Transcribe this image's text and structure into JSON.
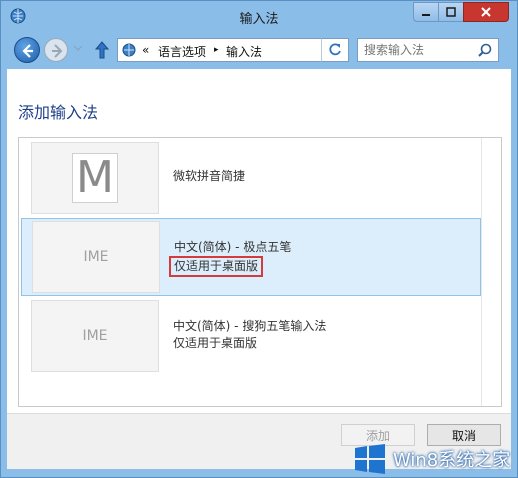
{
  "window": {
    "title": "输入法"
  },
  "address": {
    "crumb_prefix": "«",
    "crumb_1": "语言选项",
    "crumb_sep": "▸",
    "crumb_2": "输入法"
  },
  "search": {
    "placeholder": "搜索输入法"
  },
  "page": {
    "heading": "添加输入法"
  },
  "ime_list": [
    {
      "thumb": "M",
      "line1": "微软拼音简捷",
      "line2": ""
    },
    {
      "thumb": "IME",
      "line1": "中文(简体) - 极点五笔",
      "line2": "仅适用于桌面版"
    },
    {
      "thumb": "IME",
      "line1": "中文(简体) - 搜狗五笔输入法",
      "line2": "仅适用于桌面版"
    }
  ],
  "buttons": {
    "add": "添加",
    "cancel": "取消"
  },
  "watermark": {
    "text": "Win8系统之家"
  },
  "colors": {
    "frame": "#8bbde9",
    "selected_row": "#dceefc",
    "highlight_border": "#d63b3b",
    "heading": "#1f3f8a"
  }
}
